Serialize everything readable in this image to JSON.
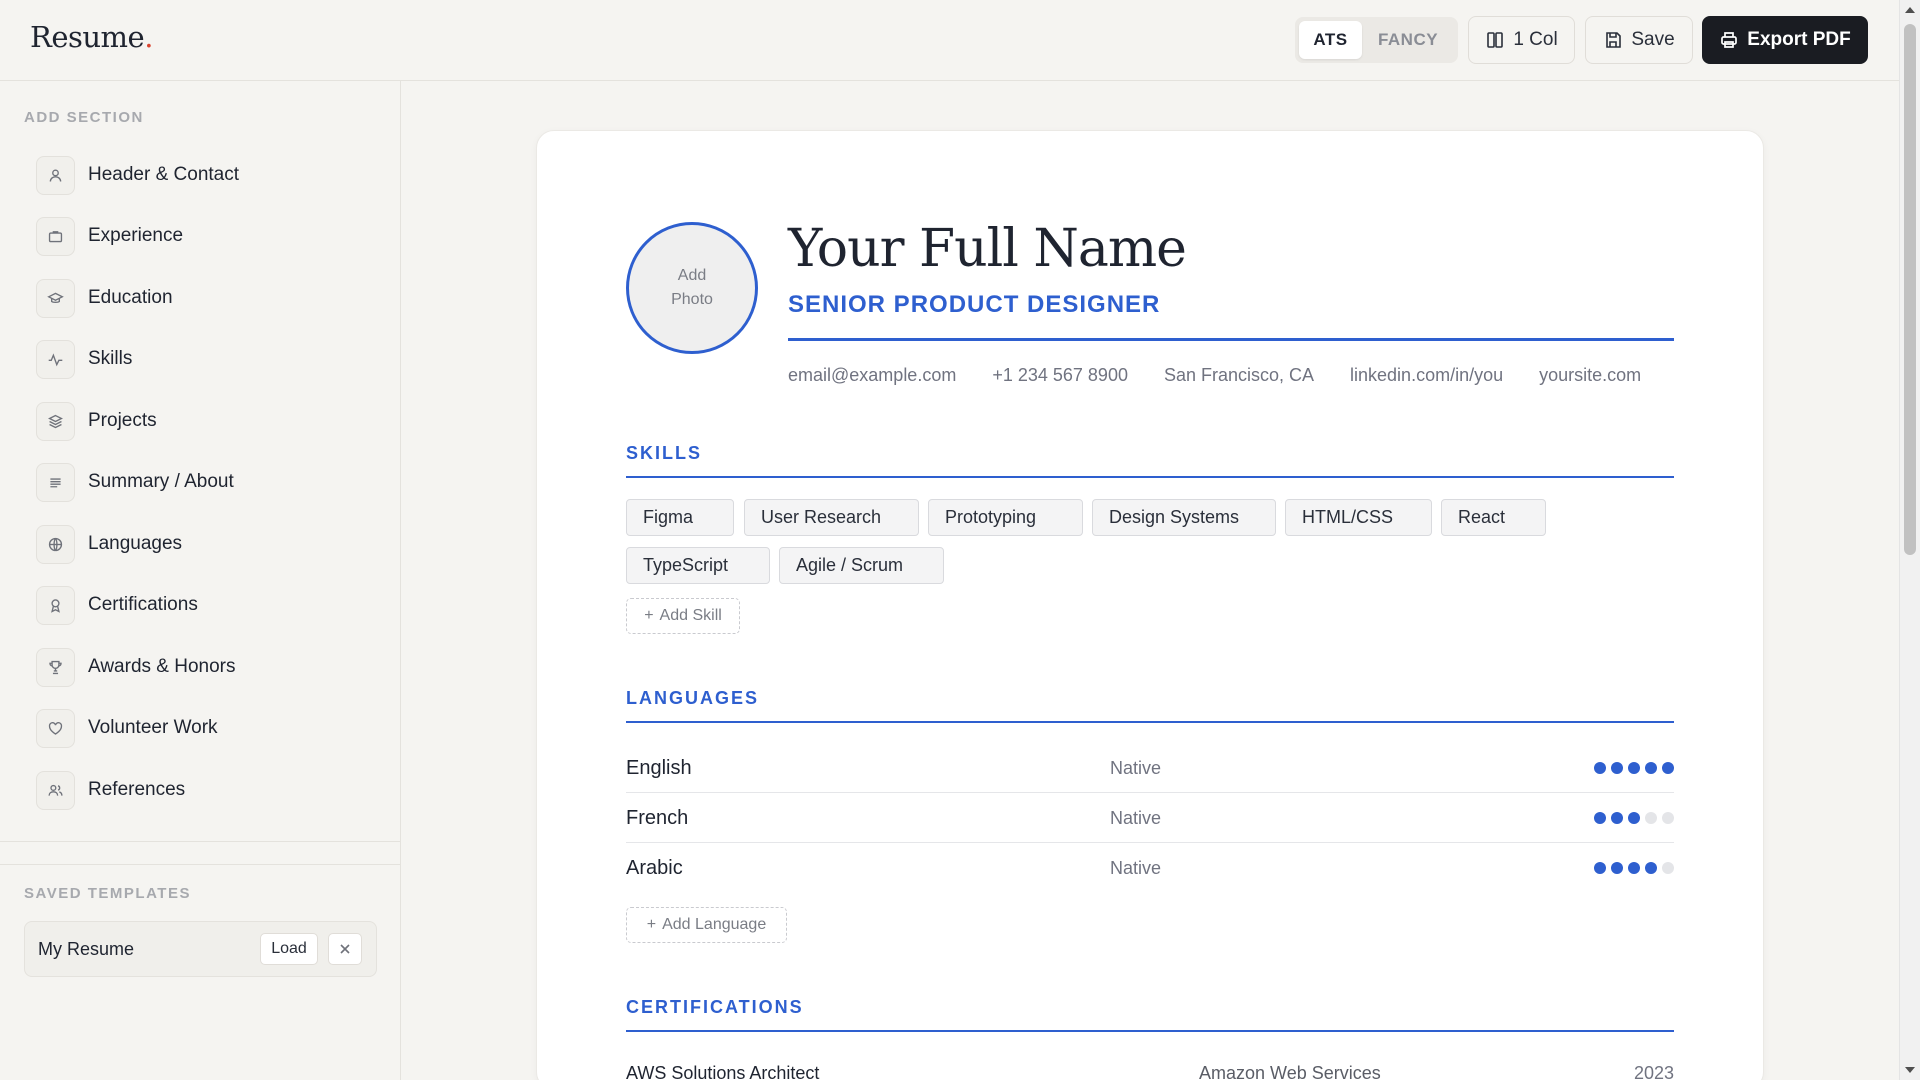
{
  "app": {
    "logo_text": "Resume",
    "logo_dot": "."
  },
  "toolbar": {
    "mode_ats": "ATS",
    "mode_fancy": "FANCY",
    "columns_label": "1 Col",
    "save_label": "Save",
    "export_label": "Export PDF"
  },
  "sidebar": {
    "add_section_label": "ADD SECTION",
    "items": [
      {
        "label": "Header & Contact",
        "icon": "user-icon"
      },
      {
        "label": "Experience",
        "icon": "briefcase-icon"
      },
      {
        "label": "Education",
        "icon": "graduation-cap-icon"
      },
      {
        "label": "Skills",
        "icon": "activity-icon"
      },
      {
        "label": "Projects",
        "icon": "layers-icon"
      },
      {
        "label": "Summary / About",
        "icon": "text-lines-icon"
      },
      {
        "label": "Languages",
        "icon": "globe-icon"
      },
      {
        "label": "Certifications",
        "icon": "award-icon"
      },
      {
        "label": "Awards & Honors",
        "icon": "trophy-icon"
      },
      {
        "label": "Volunteer Work",
        "icon": "heart-icon"
      },
      {
        "label": "References",
        "icon": "users-icon"
      }
    ],
    "saved_templates_label": "SAVED TEMPLATES",
    "templates": [
      {
        "name": "My Resume",
        "load_label": "Load"
      }
    ]
  },
  "resume": {
    "photo_label_line1": "Add",
    "photo_label_line2": "Photo",
    "full_name": "Your Full Name",
    "job_title": "SENIOR PRODUCT DESIGNER",
    "contact": {
      "email": "email@example.com",
      "phone": "+1 234 567 8900",
      "location": "San Francisco, CA",
      "linkedin": "linkedin.com/in/you",
      "website": "yoursite.com"
    },
    "skills_heading": "SKILLS",
    "skills": [
      "Figma",
      "User Research",
      "Prototyping",
      "Design Systems",
      "HTML/CSS",
      "React",
      "TypeScript",
      "Agile / Scrum"
    ],
    "add_skill_label": "Add Skill",
    "languages_heading": "LANGUAGES",
    "languages": [
      {
        "name": "English",
        "level": "Native",
        "dots": 5
      },
      {
        "name": "French",
        "level": "Native",
        "dots": 3
      },
      {
        "name": "Arabic",
        "level": "Native",
        "dots": 4
      }
    ],
    "add_language_label": "Add Language",
    "certifications_heading": "CERTIFICATIONS",
    "certifications": [
      {
        "name": "AWS Solutions Architect",
        "issuer": "Amazon Web Services",
        "year": "2023"
      }
    ]
  },
  "colors": {
    "accent": "#2e5fcf",
    "logo_dot": "#d9442f",
    "export_bg": "#1a1c22"
  }
}
